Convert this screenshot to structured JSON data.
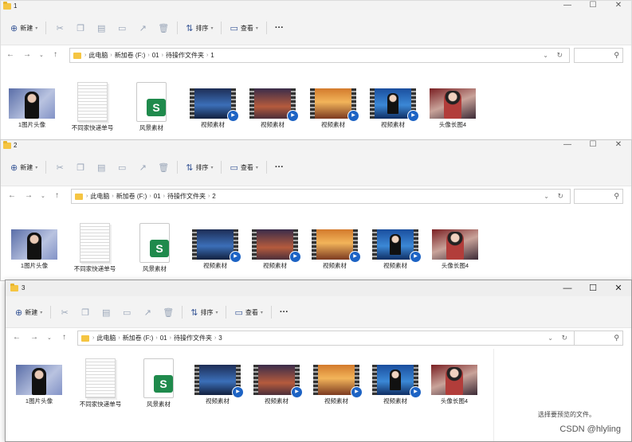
{
  "toolbar": {
    "new_label": "新建",
    "sort_label": "排序",
    "view_label": "查看",
    "more_label": "···"
  },
  "breadcrumb": [
    "此电脑",
    "新加卷 (F:)",
    "01",
    "待操作文件夹"
  ],
  "windows": [
    {
      "title": "1",
      "folder": "1"
    },
    {
      "title": "2",
      "folder": "2"
    },
    {
      "title": "3",
      "folder": "3"
    }
  ],
  "files": [
    "1图片头像",
    "不同家快递单号",
    "风景素材",
    "视频素材",
    "视频素材",
    "视频素材",
    "视频素材",
    "头像长图4"
  ],
  "preview": {
    "empty_text": "选择要预览的文件。"
  },
  "watermark": "CSDN @hlyling",
  "icons": {
    "excel_letter": "S",
    "window_controls": [
      "—",
      "☐",
      "✕"
    ]
  }
}
